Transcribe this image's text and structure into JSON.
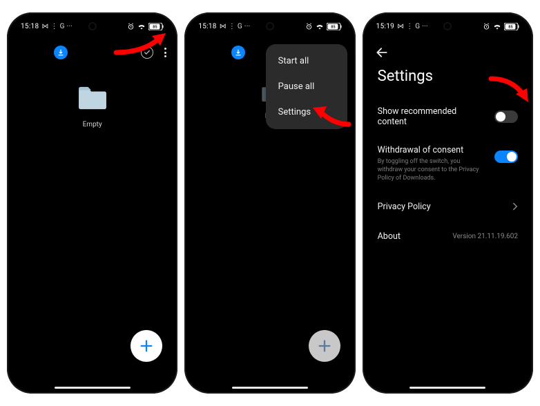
{
  "status": {
    "time_s1": "15:18",
    "time_s2": "15:18",
    "time_s3": "15:19",
    "left_indicators": "⋈ ⋮ G ···",
    "battery_pct": "85"
  },
  "screen1": {
    "folder_label": "Empty"
  },
  "screen2": {
    "folder_label": "Emp",
    "menu": {
      "start_all": "Start all",
      "pause_all": "Pause all",
      "settings": "Settings"
    }
  },
  "screen3": {
    "title": "Settings",
    "rows": {
      "recommended": {
        "title": "Show recommended content",
        "state": "off"
      },
      "withdrawal": {
        "title": "Withdrawal of consent",
        "sub": "By toggling off the switch, you withdraw your consent to the Privacy Policy of Downloads.",
        "state": "on"
      },
      "privacy": {
        "title": "Privacy Policy"
      },
      "about": {
        "title": "About",
        "version": "Version 21.11.19.602"
      }
    }
  },
  "colors": {
    "accent": "#0a84ff",
    "arrow": "#ff0000"
  }
}
